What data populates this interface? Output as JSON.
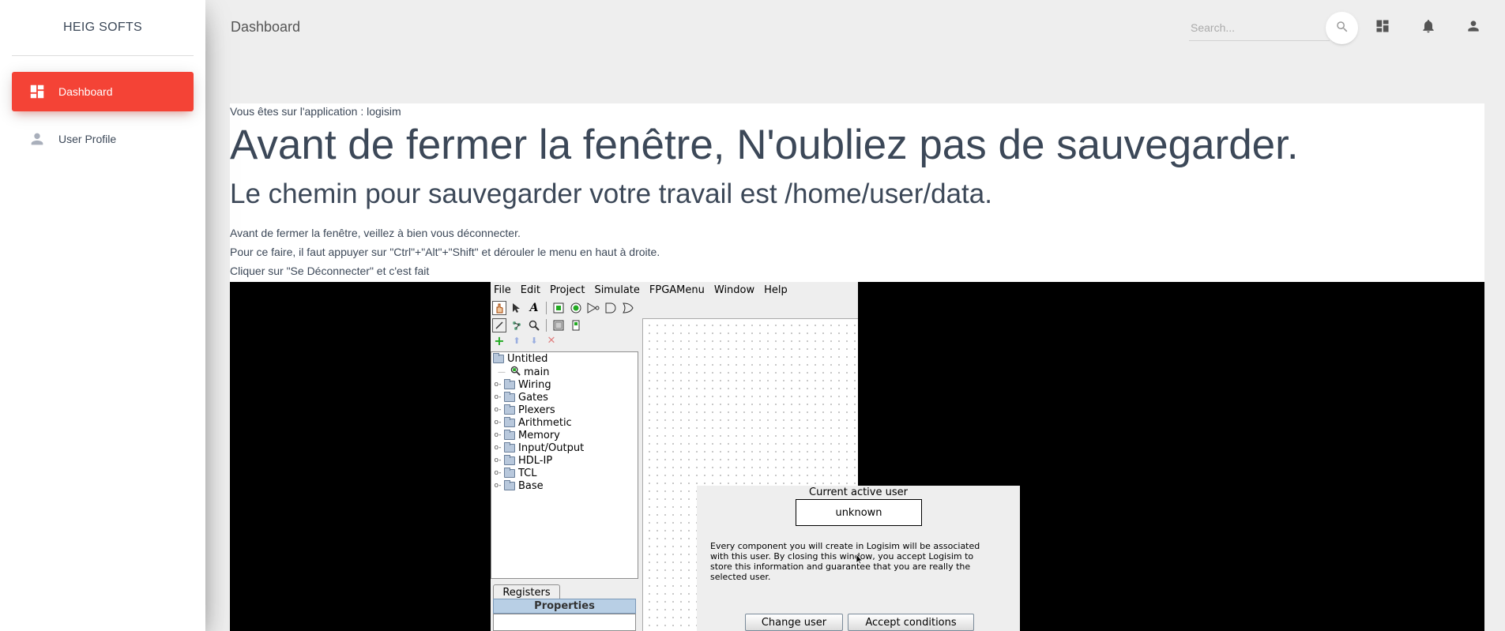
{
  "sidebar": {
    "brand": "HEIG SOFTS",
    "items": [
      {
        "label": "Dashboard",
        "icon": "dashboard-icon",
        "active": true
      },
      {
        "label": "User Profile",
        "icon": "person-icon",
        "active": false
      }
    ]
  },
  "navbar": {
    "title": "Dashboard",
    "search_placeholder": "Search...",
    "icons": [
      "search-icon",
      "dashboard-icon",
      "notifications-icon",
      "person-icon"
    ]
  },
  "content": {
    "app_line": "Vous êtes sur l'application : logisim",
    "heading1": "Avant de fermer la fenêtre, N'oubliez pas de sauvegarder.",
    "heading2": "Le chemin pour sauvegarder votre travail est /home/user/data.",
    "paragraphs": [
      "Avant de fermer la fenêtre, veillez à bien vous déconnecter.",
      "Pour ce faire, il faut appuyer sur \"Ctrl\"+\"Alt\"+\"Shift\" et dérouler le menu en haut à droite.",
      "Cliquer sur \"Se Déconnecter\" et c'est fait"
    ]
  },
  "logisim": {
    "menu": [
      "File",
      "Edit",
      "Project",
      "Simulate",
      "FPGAMenu",
      "Window",
      "Help"
    ],
    "tree_root": "Untitled",
    "tree_main": "main",
    "tree_folders": [
      "Wiring",
      "Gates",
      "Plexers",
      "Arithmetic",
      "Memory",
      "Input/Output",
      "HDL-IP",
      "TCL",
      "Base"
    ],
    "registers_tab": "Registers",
    "properties_tab": "Properties"
  },
  "dialog": {
    "title": "Current active user",
    "user": "unknown",
    "message_lines": [
      "Every component you will create in Logisim will be associated",
      "with this user. By closing this window, you accept Logisim to",
      "store this information and guarantee that you are really the",
      "selected user."
    ],
    "change_user_label": "Change user",
    "accept_label": "Accept conditions"
  },
  "colors": {
    "accent": "#f44336",
    "background": "#eeeeee",
    "text": "#3c4858"
  }
}
